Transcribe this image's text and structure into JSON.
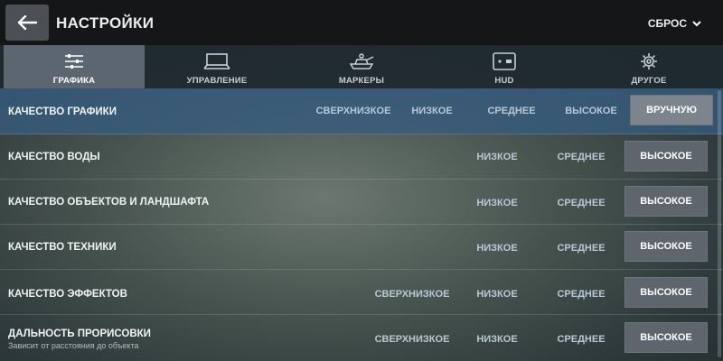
{
  "header": {
    "title": "НАСТРОЙКИ",
    "reset_label": "СБРОС",
    "back_icon": "arrow-left-icon"
  },
  "tabs": [
    {
      "label": "ГРАФИКА",
      "icon": "sliders-icon",
      "active": true
    },
    {
      "label": "УПРАВЛЕНИЕ",
      "icon": "monitor-icon",
      "active": false
    },
    {
      "label": "МАРКЕРЫ",
      "icon": "tank-icon",
      "active": false
    },
    {
      "label": "HUD",
      "icon": "minimap-icon",
      "active": false
    },
    {
      "label": "ДРУГОЕ",
      "icon": "gear-icon",
      "active": false
    }
  ],
  "settings": [
    {
      "name": "КАЧЕСТВО ГРАФИКИ",
      "options": [
        "СВЕРХНИЗКОЕ",
        "НИЗКОЕ",
        "СРЕДНЕЕ",
        "ВЫСОКОЕ",
        "ВРУЧНУЮ"
      ],
      "selected": "ВРУЧНУЮ"
    },
    {
      "name": "КАЧЕСТВО ВОДЫ",
      "options": [
        "НИЗКОЕ",
        "СРЕДНЕЕ",
        "ВЫСОКОЕ"
      ],
      "selected": "ВЫСОКОЕ"
    },
    {
      "name": "КАЧЕСТВО ОБЪЕКТОВ И ЛАНДШАФТА",
      "options": [
        "НИЗКОЕ",
        "СРЕДНЕЕ",
        "ВЫСОКОЕ"
      ],
      "selected": "ВЫСОКОЕ"
    },
    {
      "name": "КАЧЕСТВО ТЕХНИКИ",
      "options": [
        "НИЗКОЕ",
        "СРЕДНЕЕ",
        "ВЫСОКОЕ"
      ],
      "selected": "ВЫСОКОЕ"
    },
    {
      "name": "КАЧЕСТВО ЭФФЕКТОВ",
      "options": [
        "СВЕРХНИЗКОЕ",
        "НИЗКОЕ",
        "СРЕДНЕЕ",
        "ВЫСОКОЕ"
      ],
      "selected": "ВЫСОКОЕ"
    },
    {
      "name": "ДАЛЬНОСТЬ ПРОРИСОВКИ",
      "subtitle": "Зависит от расстояния до объекта",
      "options": [
        "СВЕРХНИЗКОЕ",
        "НИЗКОЕ",
        "СРЕДНЕЕ",
        "ВЫСОКОЕ"
      ],
      "selected": "ВЫСОКОЕ"
    }
  ]
}
